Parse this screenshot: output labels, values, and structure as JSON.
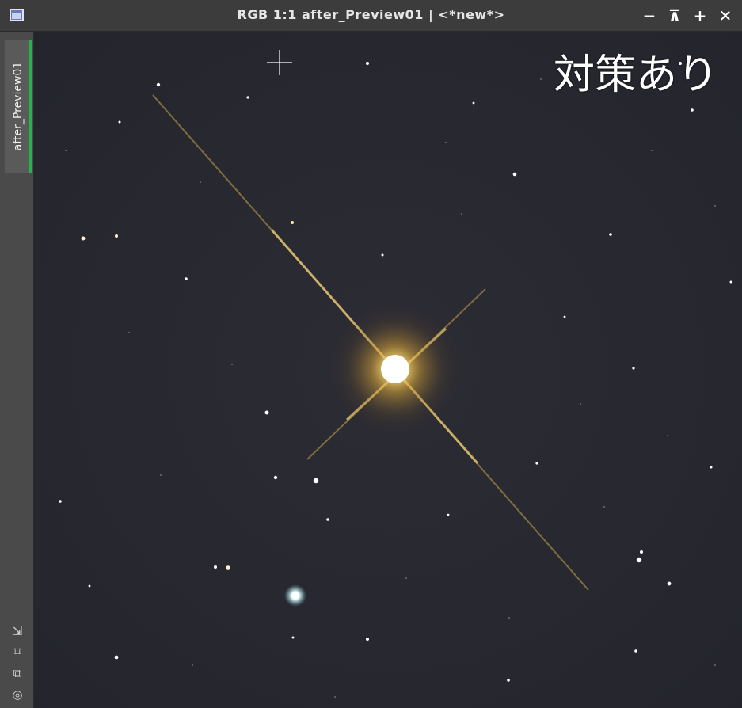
{
  "window": {
    "title": "RGB 1:1 after_Preview01 | <*new*>",
    "controls": [
      "−",
      "⊼",
      "+",
      "✕"
    ]
  },
  "sidebar": {
    "tab_label": "after_Preview01",
    "tools": [
      "⇲",
      "⌑",
      "⧉",
      "◎"
    ],
    "accent_color": "#27b14f"
  },
  "image": {
    "overlay_label": "対策あり",
    "background_color": "#262730"
  }
}
